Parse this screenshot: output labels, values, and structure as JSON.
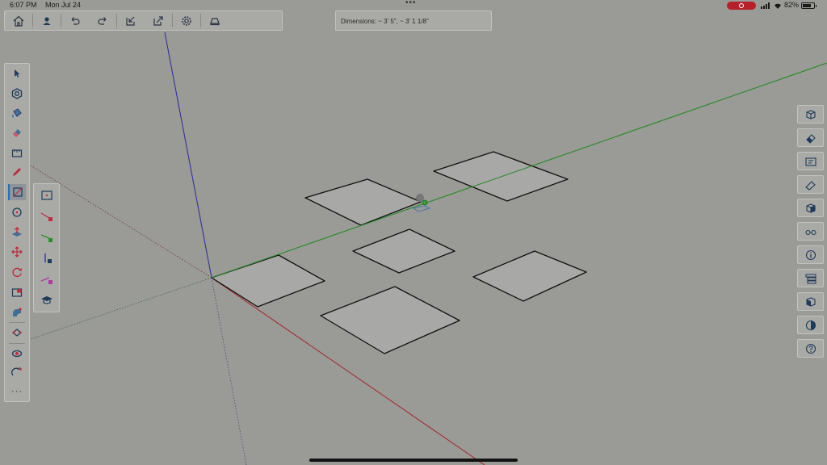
{
  "status_bar": {
    "time": "6:07 PM",
    "date": "Mon Jul 24",
    "dots": "•••",
    "battery": "82%"
  },
  "top_toolbar": {
    "buttons": [
      "home-icon",
      "account-icon",
      "undo-icon",
      "redo-icon",
      "import-icon",
      "export-icon",
      "settings-icon",
      "display-icon"
    ]
  },
  "measurement": {
    "text": "Dimensions: ~ 3' 5\", ~ 3' 1 1/8\""
  },
  "left_toolbar": {
    "tools": [
      "select-icon",
      "orbit-icon",
      "paint-bucket-icon",
      "eraser-icon",
      "tape-measure-icon",
      "pencil-icon",
      "rectangle-icon",
      "circle-icon",
      "push-pull-icon",
      "move-icon",
      "rotate-icon",
      "scale-icon",
      "follow-me-icon",
      "solid-tools-icon",
      "section-plane-icon",
      "xray-icon"
    ],
    "active_tool": "rectangle-icon",
    "more_label": "···"
  },
  "sub_toolbar": {
    "tools": [
      "rectangle-basic-icon",
      "rect-lock-red-icon",
      "rect-lock-green-icon",
      "rect-lock-blue-icon",
      "rect-lock-magenta-icon",
      "instructor-icon"
    ]
  },
  "right_panel": {
    "buttons": [
      "component-icon",
      "eraser-panel-icon",
      "scenes-icon",
      "materials-icon",
      "views-icon",
      "display-style-icon",
      "entity-info-icon",
      "outliner-icon",
      "components-panel-icon",
      "styles-icon",
      "help-icon"
    ]
  },
  "colors": {
    "background": "#9a9a96",
    "axis_red": "#a3262a",
    "axis_green": "#2e8b2e",
    "axis_blue": "#2a2a9a",
    "accent": "#2c6fb0"
  }
}
